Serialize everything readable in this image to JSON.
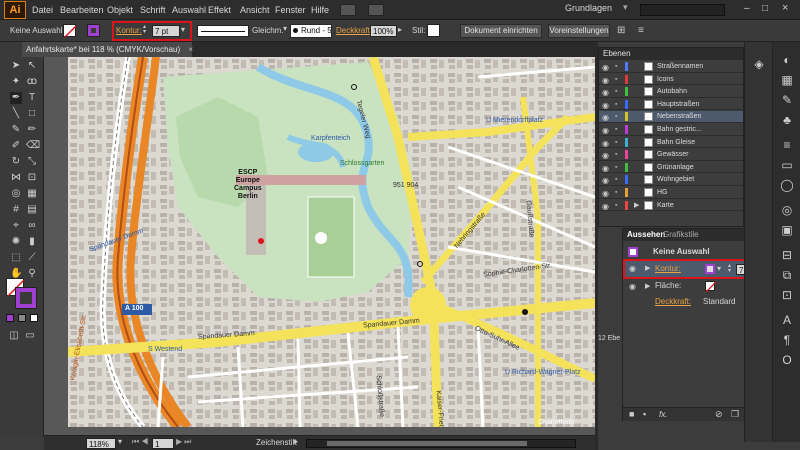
{
  "app": {
    "logo": "Ai"
  },
  "menu": [
    "Datei",
    "Bearbeiten",
    "Objekt",
    "Schrift",
    "Auswahl",
    "Effekt",
    "Ansicht",
    "Fenster",
    "Hilfe"
  ],
  "workspace": {
    "name": "Grundlagen"
  },
  "options_bar": {
    "selection": "Keine Auswahl",
    "stroke_label": "Kontur:",
    "stroke_value": "7 pt",
    "profile": "Gleichm.",
    "brush": "Rund - 5 Pt.",
    "opacity_label": "Deckkraft:",
    "opacity_value": "100%",
    "style_label": "Stil:",
    "doc_setup": "Dokument einrichten",
    "preferences": "Voreinstellungen"
  },
  "document_tab": {
    "title": "Anfahrtskarte* bei 118 % (CMYK/Vorschau)",
    "close": "×"
  },
  "status_bar": {
    "zoom": "118%",
    "page": "1",
    "tool": "Zeichenstift"
  },
  "layers_panel": {
    "tab": "Ebenen",
    "layers": [
      {
        "name": "Straßennamen",
        "color": "#4a7cff"
      },
      {
        "name": "Icons",
        "color": "#e23a3a"
      },
      {
        "name": "Autobahn",
        "color": "#3fbf3f"
      },
      {
        "name": "Hauptstraßen",
        "color": "#3a6bff"
      },
      {
        "name": "Nebenstraßen",
        "color": "#d4c220"
      },
      {
        "name": "Bahn gestric...",
        "color": "#c03ad6"
      },
      {
        "name": "Bahn Gleise",
        "color": "#3fb0d0"
      },
      {
        "name": "Gewässer",
        "color": "#ee4499"
      },
      {
        "name": "Grünanlage",
        "color": "#3fbf3f"
      },
      {
        "name": "Wohngebiet",
        "color": "#3a6bff"
      },
      {
        "name": "HG",
        "color": "#e2a23a"
      },
      {
        "name": "Karte",
        "color": "#ee4444"
      }
    ],
    "count": "12 Ebe"
  },
  "appearance_panel": {
    "tab1": "Aussehen",
    "tab2": "Grafikstile",
    "title": "Keine Auswahl",
    "stroke_label": "Kontur:",
    "stroke_value": "7 pt",
    "fill_label": "Fläche:",
    "opacity_label": "Deckkraft:",
    "opacity_value": "Standard",
    "fx": "fx."
  },
  "map_labels": {
    "spandauer_damm": "Spandauer Damm",
    "spandauer_damm_west": "Spandauer Damm",
    "s_westend": "S Westend",
    "a100": "A 100",
    "tegeler_weg": "Tegeler Weg",
    "u_mierendorff": "U Mierendorffplatz",
    "nehringstrasse": "Nehringstraße",
    "schlossgarten": "Schlossgarten",
    "karpfenteich": "Karpfenteich",
    "schlossstrasse": "Schloßstraße",
    "otto_suhr": "Otto-Suhr-Allee",
    "u_richard_wagner": "U Richard-Wagner-Platz",
    "sophie_charlotte": "Sophie-Charlotten-Str.",
    "escp": [
      "ESCP",
      "Europe",
      "Campus",
      "Berlin"
    ],
    "b_951": "951 904",
    "kaiserdamm": "Kaiserdamm",
    "charlottenburg": "Charlottenb...",
    "luisenplatz": "Luisenplatz",
    "kaiser_friedrich": "Kaiser-Friedrich-Str.",
    "gaussstrasse": "Gaußstraße",
    "wilmersdorfer": "Wilmersdorfer Str.",
    "kohlenstr": "Königin-Elisabeth-Str."
  },
  "colors": {
    "accent": "#d9151b",
    "road_main": "#f4e35a",
    "autobahn": "#e98625",
    "park": "#c9e2c0",
    "water": "#8fc9e8"
  }
}
